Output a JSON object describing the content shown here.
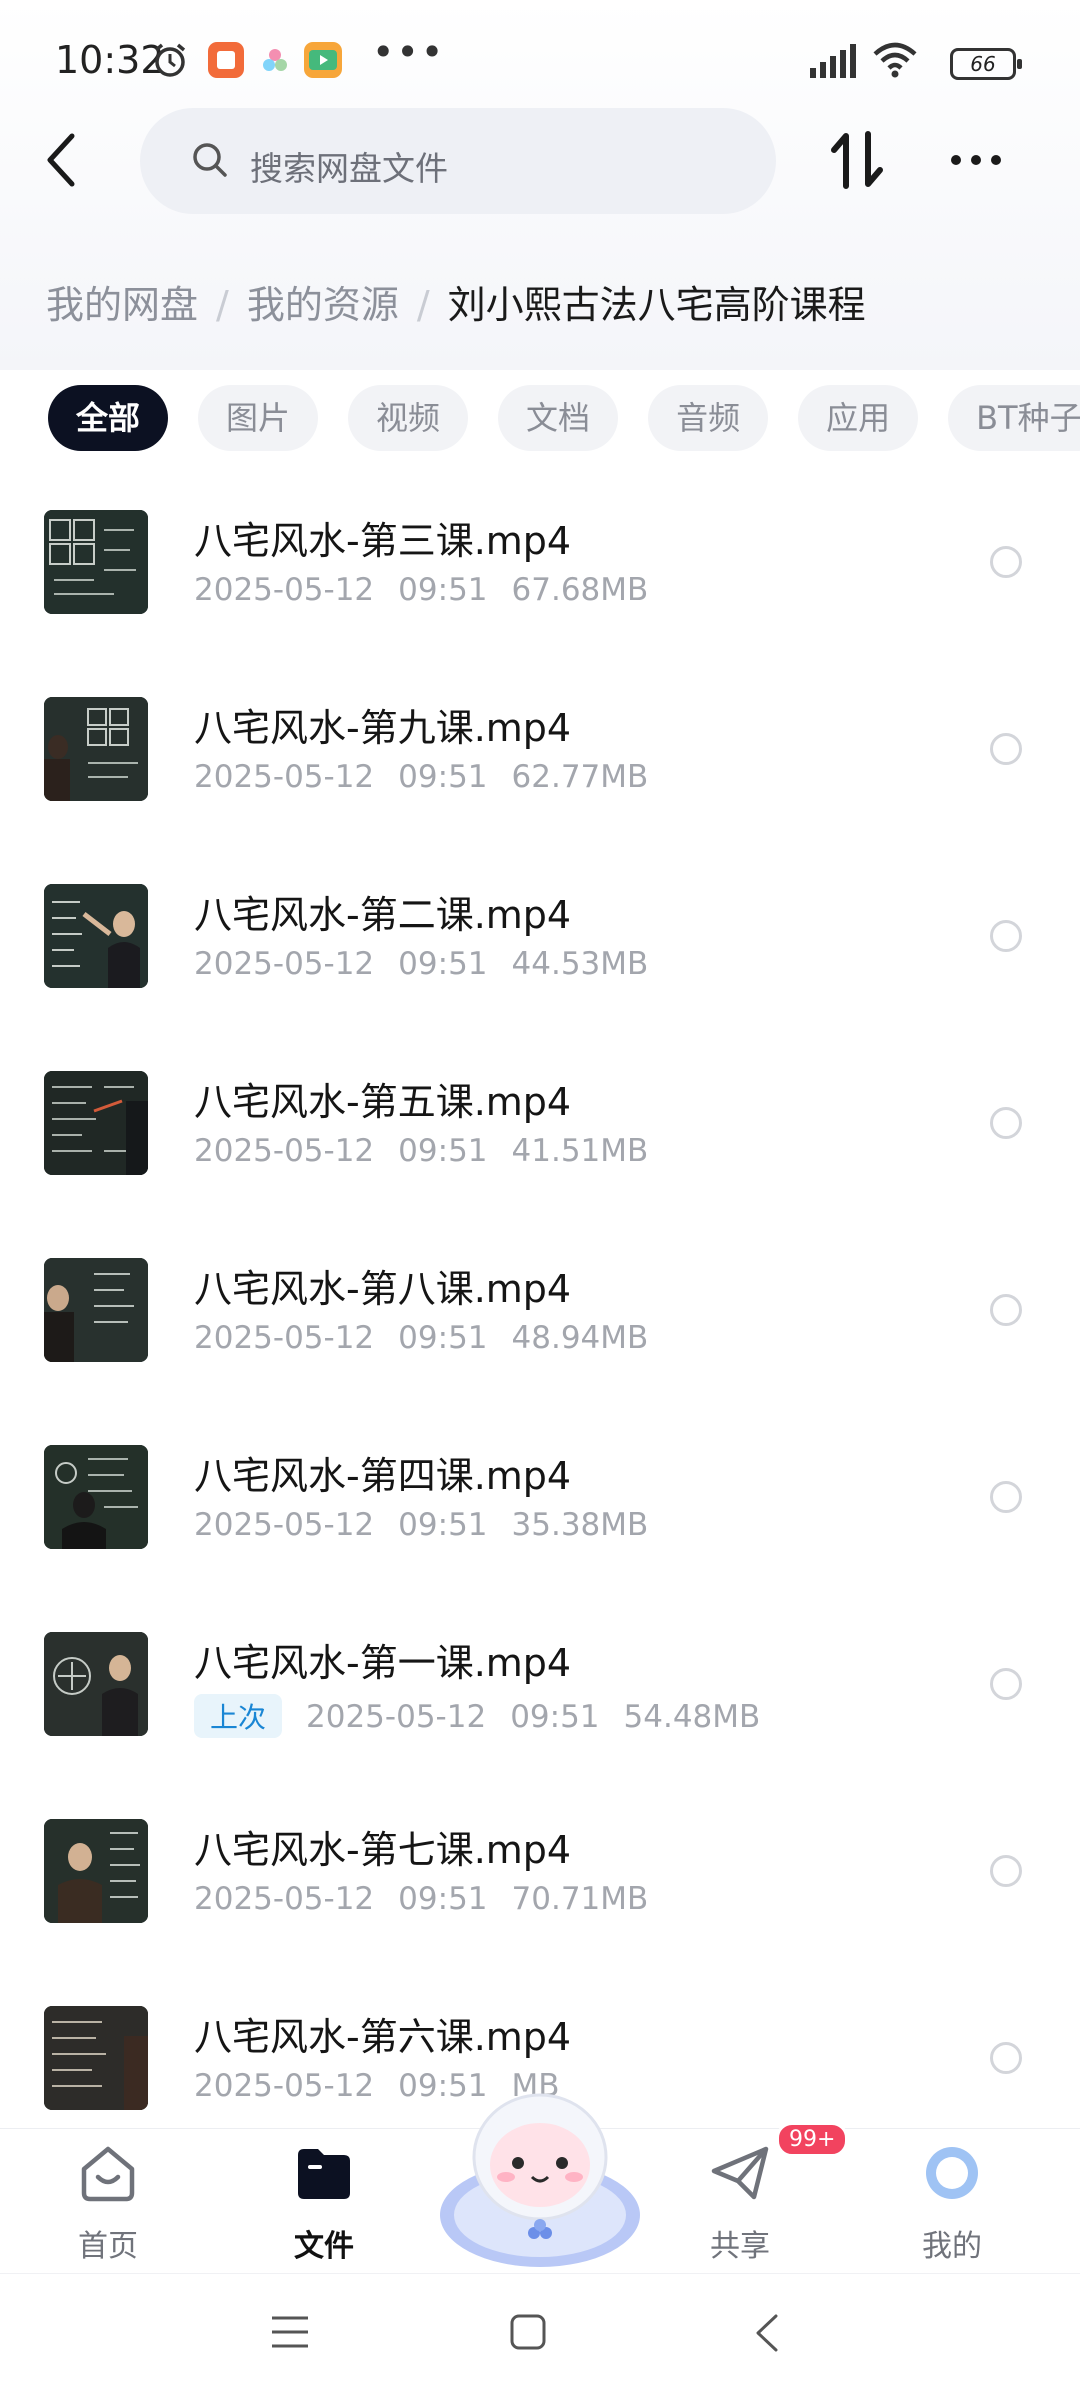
{
  "status_bar": {
    "time": "10:32",
    "overflow": "•••",
    "battery": "66",
    "icons": [
      "alarm-icon",
      "app-icon-orange",
      "app-icon-flower",
      "app-icon-video",
      "signal-icon",
      "wifi-icon"
    ]
  },
  "header": {
    "search_placeholder": "搜索网盘文件",
    "icons": [
      "back-arrow-icon",
      "search-icon",
      "sort-icon",
      "more-icon"
    ]
  },
  "breadcrumb": {
    "items": [
      "我的网盘",
      "我的资源"
    ],
    "separator": "/",
    "current": "刘小熙古法八宅高阶课程"
  },
  "filter_tabs": [
    {
      "label": "全部",
      "active": true
    },
    {
      "label": "图片",
      "active": false
    },
    {
      "label": "视频",
      "active": false
    },
    {
      "label": "文档",
      "active": false
    },
    {
      "label": "音频",
      "active": false
    },
    {
      "label": "应用",
      "active": false
    },
    {
      "label": "BT种子",
      "active": false
    }
  ],
  "files": [
    {
      "name": "八宅风水-第三课.mp4",
      "date": "2025-05-12",
      "time": "09:51",
      "size": "67.68MB",
      "badge": ""
    },
    {
      "name": "八宅风水-第九课.mp4",
      "date": "2025-05-12",
      "time": "09:51",
      "size": "62.77MB",
      "badge": ""
    },
    {
      "name": "八宅风水-第二课.mp4",
      "date": "2025-05-12",
      "time": "09:51",
      "size": "44.53MB",
      "badge": ""
    },
    {
      "name": "八宅风水-第五课.mp4",
      "date": "2025-05-12",
      "time": "09:51",
      "size": "41.51MB",
      "badge": ""
    },
    {
      "name": "八宅风水-第八课.mp4",
      "date": "2025-05-12",
      "time": "09:51",
      "size": "48.94MB",
      "badge": ""
    },
    {
      "name": "八宅风水-第四课.mp4",
      "date": "2025-05-12",
      "time": "09:51",
      "size": "35.38MB",
      "badge": ""
    },
    {
      "name": "八宅风水-第一课.mp4",
      "date": "2025-05-12",
      "time": "09:51",
      "size": "54.48MB",
      "badge": "上次"
    },
    {
      "name": "八宅风水-第七课.mp4",
      "date": "2025-05-12",
      "time": "09:51",
      "size": "70.71MB",
      "badge": ""
    },
    {
      "name": "八宅风水-第六课.mp4",
      "date": "2025-05-12",
      "time": "09:51",
      "size": "MB",
      "badge": ""
    }
  ],
  "bottom_nav": {
    "home": "首页",
    "files": "文件",
    "share": "共享",
    "share_badge": "99+",
    "mine": "我的",
    "active": "files"
  },
  "colors": {
    "accent_dark": "#0c1122",
    "badge_red": "#f2435f",
    "link_blue": "#1a86d4"
  }
}
